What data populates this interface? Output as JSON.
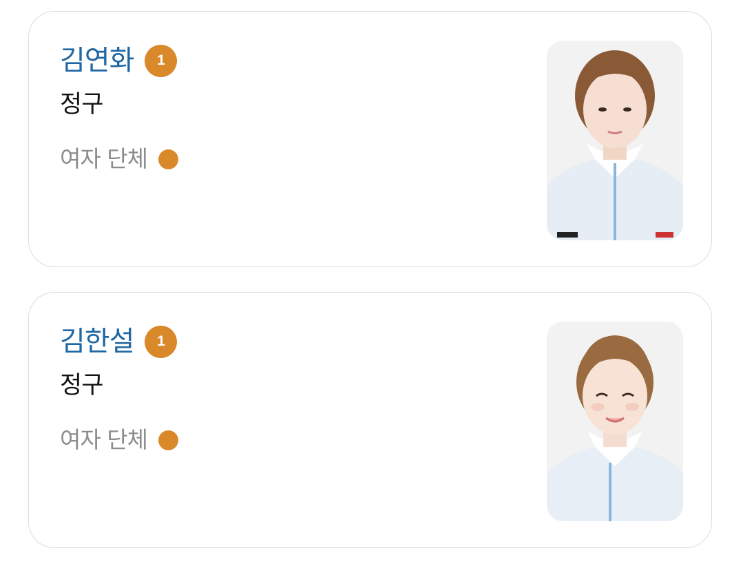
{
  "athletes": [
    {
      "name": "김연화",
      "rank": "1",
      "sport": "정구",
      "event": "여자 단체",
      "medal_color": "#d9892a",
      "photo_icon": "athlete-portrait"
    },
    {
      "name": "김한설",
      "rank": "1",
      "sport": "정구",
      "event": "여자 단체",
      "medal_color": "#d9892a",
      "photo_icon": "athlete-portrait"
    }
  ],
  "colors": {
    "name": "#1f67a3",
    "sport": "#141414",
    "event": "#8c8c8c",
    "badge": "#d9892a",
    "border": "#dcdcdc"
  }
}
